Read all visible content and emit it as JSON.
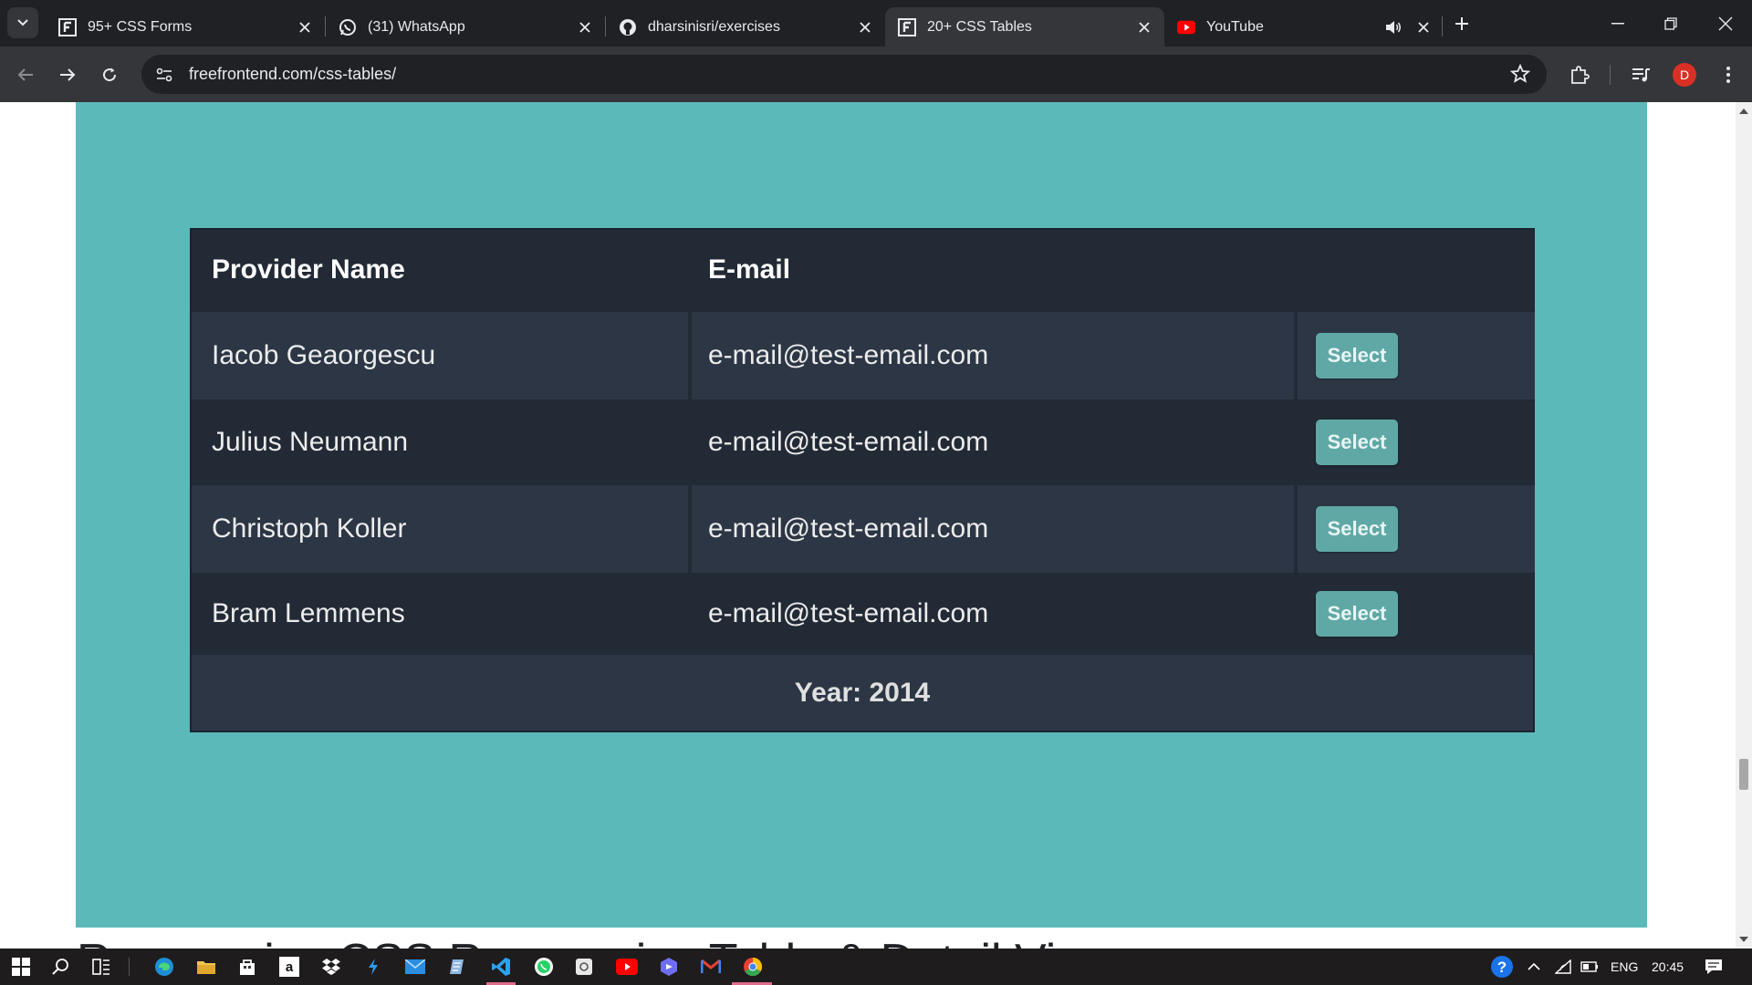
{
  "browser": {
    "tabs": [
      {
        "title": "95+ CSS Forms",
        "favicon": "freefrontend-icon",
        "active": false
      },
      {
        "title": "(31) WhatsApp",
        "favicon": "whatsapp-icon",
        "active": false
      },
      {
        "title": "dharsinisri/exercises",
        "favicon": "github-icon",
        "active": false
      },
      {
        "title": "20+ CSS Tables",
        "favicon": "freefrontend-icon",
        "active": true
      },
      {
        "title": "YouTube",
        "favicon": "youtube-icon",
        "active": false,
        "audio": true
      }
    ],
    "url": "freefrontend.com/css-tables/",
    "profile_initial": "D"
  },
  "page": {
    "table": {
      "headers": [
        "Provider Name",
        "E-mail",
        ""
      ],
      "rows": [
        {
          "name": "Iacob Geaorgescu",
          "email": "e-mail@test-email.com",
          "action": "Select"
        },
        {
          "name": "Julius Neumann",
          "email": "e-mail@test-email.com",
          "action": "Select"
        },
        {
          "name": "Christoph Koller",
          "email": "e-mail@test-email.com",
          "action": "Select"
        },
        {
          "name": "Bram Lemmens",
          "email": "e-mail@test-email.com",
          "action": "Select"
        }
      ],
      "footer": "Year: 2014"
    },
    "next_heading": "Responsive CSS Responsive Table & Detail View"
  },
  "taskbar": {
    "language": "ENG",
    "time": "20:45"
  },
  "colors": {
    "panel": "#5bbab9",
    "table_dark": "#222a36",
    "table_light": "#2c3645",
    "button": "#5fa8a6"
  }
}
